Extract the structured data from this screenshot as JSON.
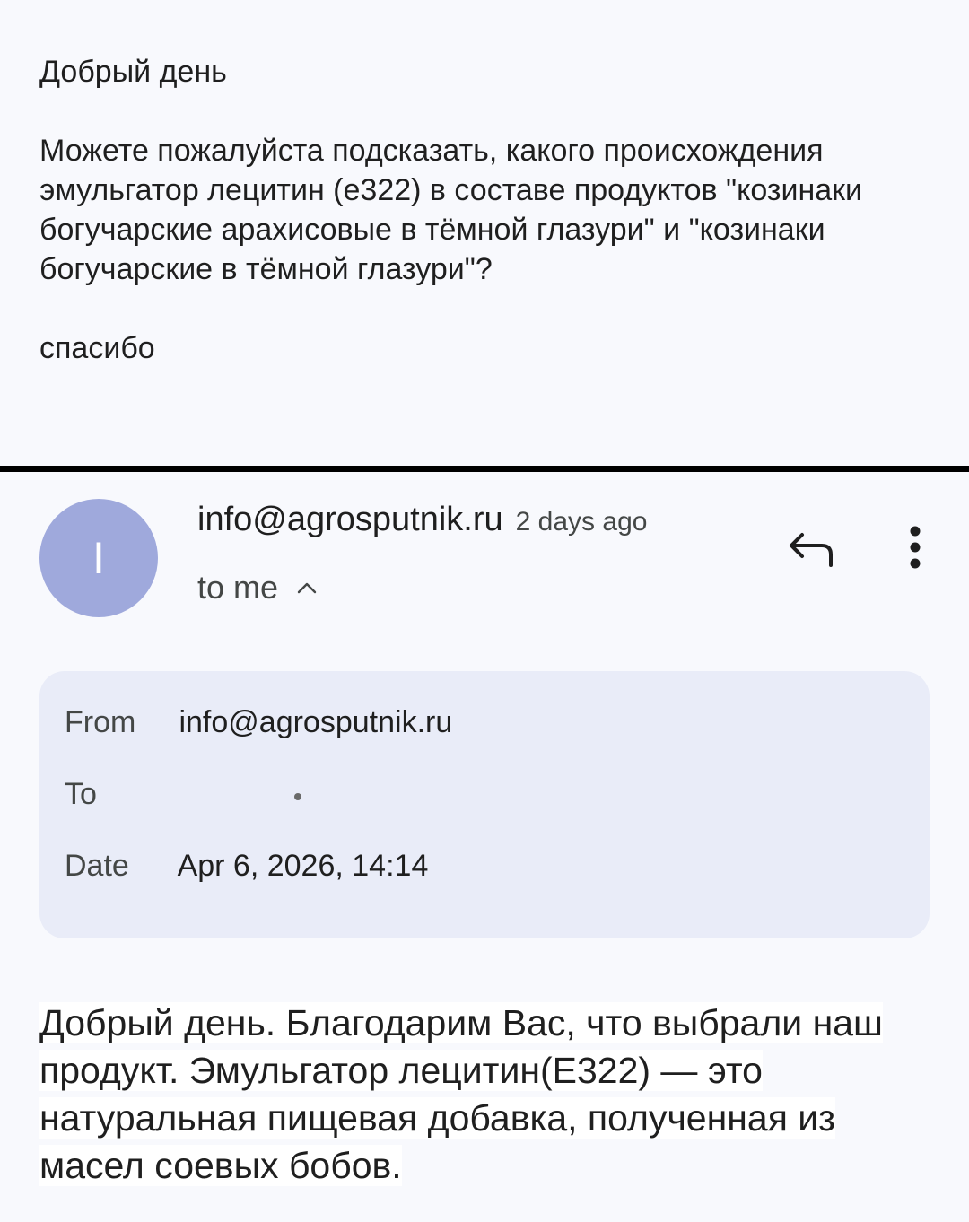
{
  "quoted_message": {
    "greeting": "Добрый день",
    "question": "Можете пожалуйста подсказать, какого происхождения эмульгатор лецитин (е322) в составе продуктов \"козинаки богучарские арахисовые в тёмной глазури\" и \"козинаки богучарские в тёмной глазури\"?",
    "thanks": "спасибо"
  },
  "message_header": {
    "avatar_letter": "I",
    "avatar_color": "#9fa9dc",
    "sender": "info@agrosputnik.ru",
    "time_ago": "2 days ago",
    "recipient": "to me",
    "icons": [
      "chevron-up-icon",
      "reply-icon",
      "more-vert-icon"
    ]
  },
  "details": {
    "from_label": "From",
    "from_value": "info@agrosputnik.ru",
    "to_label": "To",
    "to_value": "",
    "date_label": "Date",
    "date_value": "Apr 6, 2026, 14:14"
  },
  "reply_body": {
    "text": "Добрый день. Благодарим Вас, что выбрали наш продукт. Эмульгатор лецитин(Е322) — это натуральная пищевая добавка, полученная из масел соевых бобов."
  }
}
